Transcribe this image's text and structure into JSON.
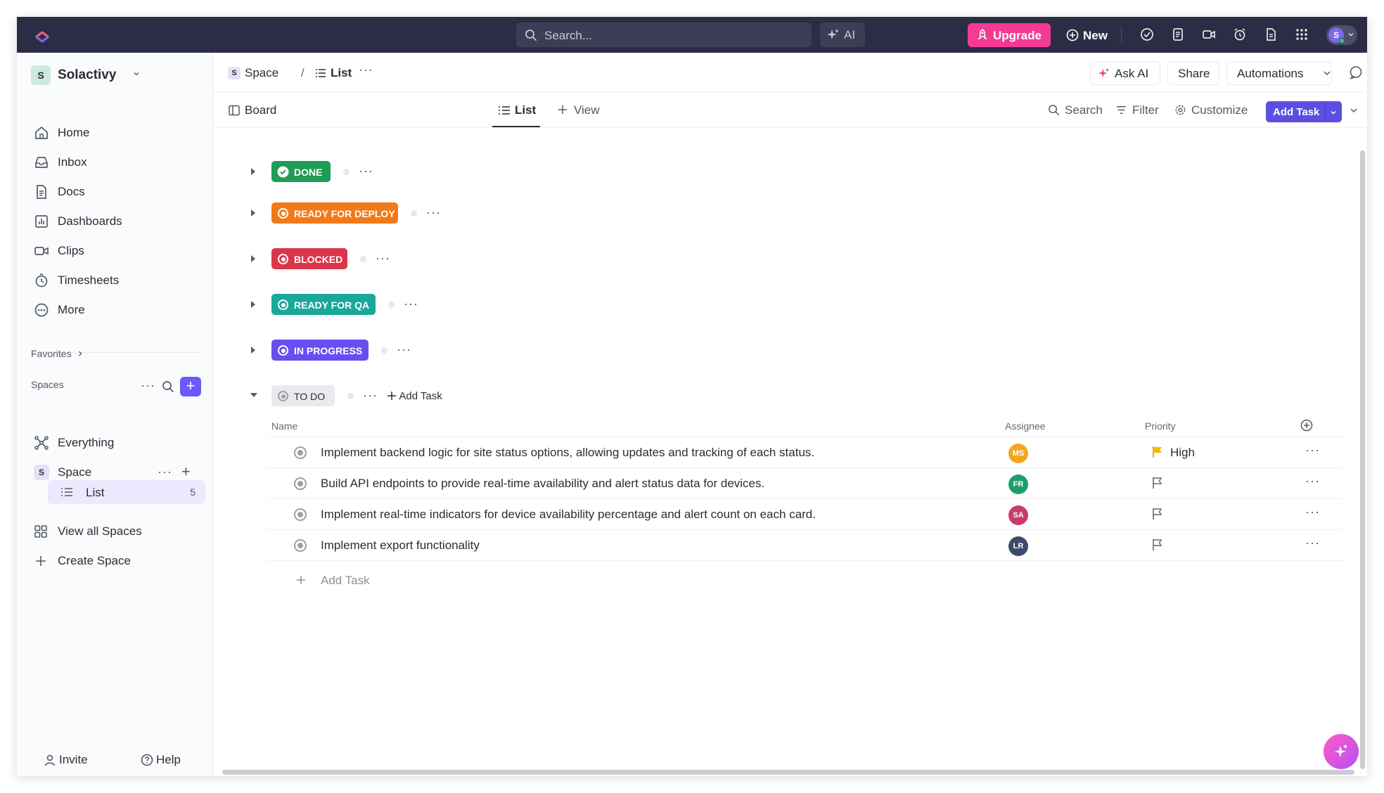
{
  "topbar": {
    "search_placeholder": "Search...",
    "ai_label": "AI",
    "upgrade_label": "Upgrade",
    "new_label": "New",
    "user_initial": "S",
    "colors": {
      "bar": "#2c2d45",
      "upgrade": "#f53a93"
    }
  },
  "sidebar": {
    "workspace": {
      "initial": "S",
      "name": "Solactivy"
    },
    "nav": [
      {
        "label": "Home",
        "icon": "home-icon"
      },
      {
        "label": "Inbox",
        "icon": "inbox-icon"
      },
      {
        "label": "Docs",
        "icon": "docs-icon"
      },
      {
        "label": "Dashboards",
        "icon": "dashboards-icon"
      },
      {
        "label": "Clips",
        "icon": "clips-icon"
      },
      {
        "label": "Timesheets",
        "icon": "timesheets-icon"
      },
      {
        "label": "More",
        "icon": "more-icon"
      }
    ],
    "favorites_label": "Favorites",
    "spaces_label": "Spaces",
    "everything_label": "Everything",
    "space": {
      "initial": "S",
      "name": "Space"
    },
    "list": {
      "name": "List",
      "count": "5"
    },
    "view_all_label": "View all Spaces",
    "create_space_label": "Create Space",
    "invite_label": "Invite",
    "help_label": "Help"
  },
  "breadcrumb": {
    "space_initial": "S",
    "space": "Space",
    "separator": "/",
    "list": "List"
  },
  "header_actions": {
    "ask_ai": "Ask AI",
    "share": "Share",
    "automations": "Automations"
  },
  "views": {
    "board": "Board",
    "list": "List",
    "add_view": "View",
    "search": "Search",
    "filter": "Filter",
    "customize": "Customize",
    "add_task": "Add Task"
  },
  "groups": [
    {
      "label": "DONE",
      "color": "#1f9d55"
    },
    {
      "label": "READY FOR DEPLOY",
      "color": "#f07a1a"
    },
    {
      "label": "BLOCKED",
      "color": "#d9364b"
    },
    {
      "label": "READY FOR QA",
      "color": "#1aa89a"
    },
    {
      "label": "IN PROGRESS",
      "color": "#6a4df0"
    },
    {
      "label": "TO DO",
      "color": "#e9eaed",
      "add_task": "Add Task"
    }
  ],
  "table": {
    "columns": {
      "name": "Name",
      "assignee": "Assignee",
      "priority": "Priority"
    },
    "rows": [
      {
        "name": "Implement backend logic for site status options, allowing updates and tracking of each status.",
        "assignee": "MS",
        "assignee_color": "#f5a524",
        "priority": "High"
      },
      {
        "name": "Build API endpoints to provide real-time availability and alert status data for devices.",
        "assignee": "FR",
        "assignee_color": "#1f9d6a",
        "priority": ""
      },
      {
        "name": "Implement real-time indicators for device availability percentage and alert count on each card.",
        "assignee": "SA",
        "assignee_color": "#c83c6b",
        "priority": ""
      },
      {
        "name": "Implement export functionality",
        "assignee": "LR",
        "assignee_color": "#3d4a6b",
        "priority": ""
      }
    ],
    "add_task": "Add Task"
  }
}
